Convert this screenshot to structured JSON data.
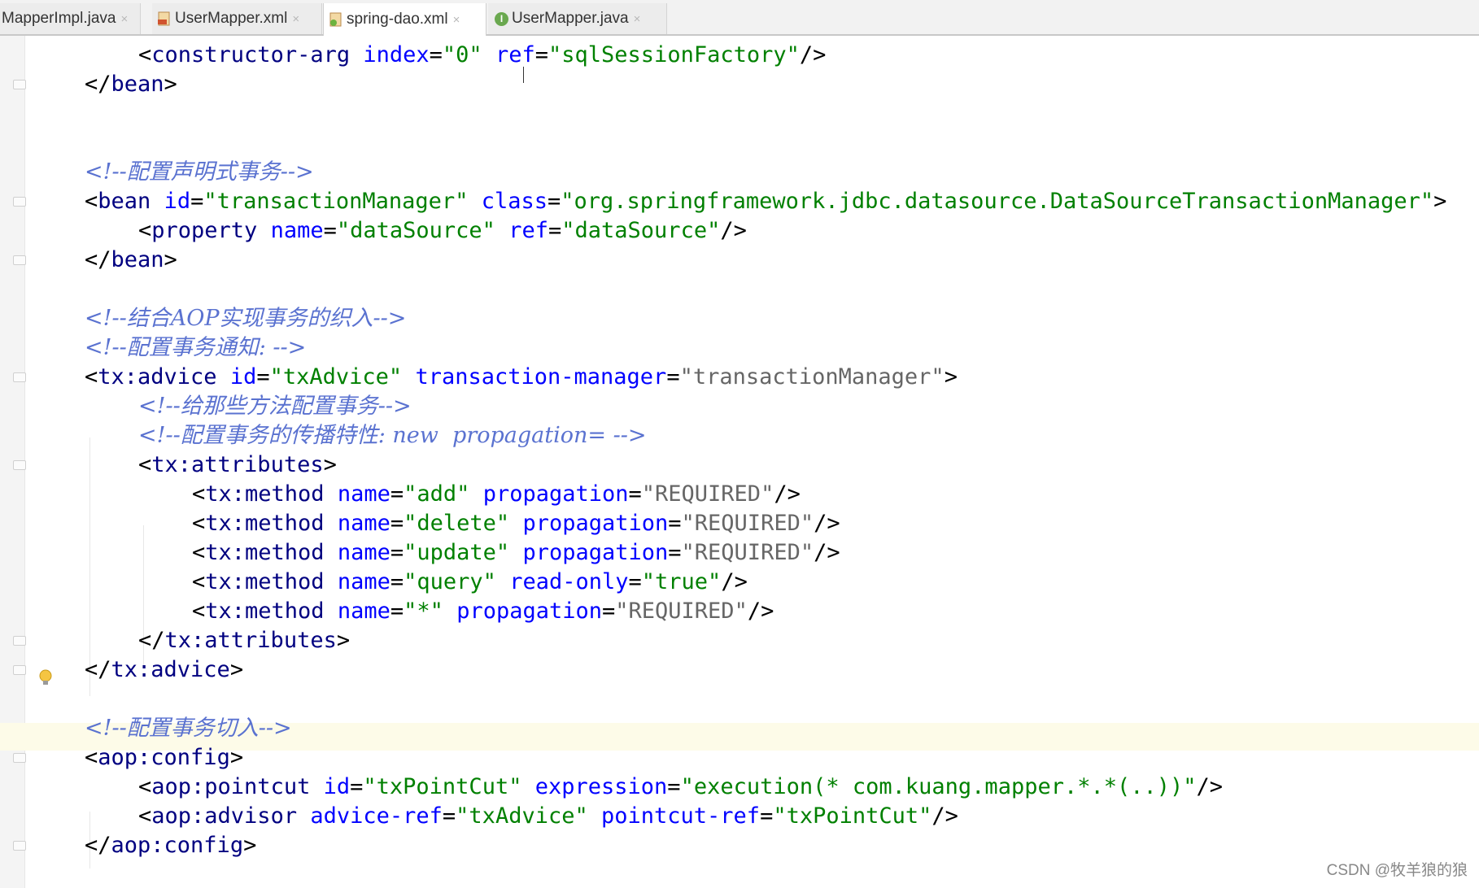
{
  "tabs": [
    {
      "label": "MapperImpl.java",
      "active": false
    },
    {
      "label": "UserMapper.xml",
      "active": false
    },
    {
      "label": "spring-dao.xml",
      "active": true
    },
    {
      "label": "UserMapper.java",
      "active": false
    }
  ],
  "tab_close_glyph": "×",
  "code_lines": [
    {
      "segments": [
        [
          "ang",
          "<"
        ],
        [
          "tag",
          "constructor-arg"
        ],
        [
          "ang",
          " "
        ],
        [
          "attr",
          "index"
        ],
        [
          "ang",
          "="
        ],
        [
          "val",
          "\"0\""
        ],
        [
          "ang",
          " "
        ],
        [
          "attr",
          "ref"
        ],
        [
          "ang",
          "="
        ],
        [
          "val",
          "\"sqlSessionFactory\""
        ],
        [
          "ang",
          "/>"
        ]
      ],
      "indent": 1
    },
    {
      "segments": [
        [
          "ang",
          "</"
        ],
        [
          "tag",
          "bean"
        ],
        [
          "ang",
          ">"
        ]
      ],
      "indent": 0
    },
    {
      "segments": [],
      "indent": 0
    },
    {
      "segments": [],
      "indent": 0
    },
    {
      "segments": [
        [
          "cmt",
          "<!--配置声明式事务-->"
        ]
      ],
      "indent": 0
    },
    {
      "segments": [
        [
          "ang",
          "<"
        ],
        [
          "tag",
          "bean"
        ],
        [
          "ang",
          " "
        ],
        [
          "attr",
          "id"
        ],
        [
          "ang",
          "="
        ],
        [
          "val",
          "\"transactionManager\""
        ],
        [
          "ang",
          " "
        ],
        [
          "attr",
          "class"
        ],
        [
          "ang",
          "="
        ],
        [
          "val",
          "\"org.springframework.jdbc.datasource.DataSourceTransactionManager\""
        ],
        [
          "ang",
          ">"
        ]
      ],
      "indent": 0
    },
    {
      "segments": [
        [
          "ang",
          "<"
        ],
        [
          "tag",
          "property"
        ],
        [
          "ang",
          " "
        ],
        [
          "attr",
          "name"
        ],
        [
          "ang",
          "="
        ],
        [
          "val",
          "\"dataSource\""
        ],
        [
          "ang",
          " "
        ],
        [
          "attr",
          "ref"
        ],
        [
          "ang",
          "="
        ],
        [
          "val",
          "\"dataSource\""
        ],
        [
          "ang",
          "/>"
        ]
      ],
      "indent": 1
    },
    {
      "segments": [
        [
          "ang",
          "</"
        ],
        [
          "tag",
          "bean"
        ],
        [
          "ang",
          ">"
        ]
      ],
      "indent": 0
    },
    {
      "segments": [],
      "indent": 0
    },
    {
      "segments": [
        [
          "cmt",
          "<!--结合AOP实现事务的织入-->"
        ]
      ],
      "indent": 0
    },
    {
      "segments": [
        [
          "cmt",
          "<!--配置事务通知: -->"
        ]
      ],
      "indent": 0
    },
    {
      "segments": [
        [
          "ang",
          "<"
        ],
        [
          "tag",
          "tx:advice"
        ],
        [
          "ang",
          " "
        ],
        [
          "attr",
          "id"
        ],
        [
          "ang",
          "="
        ],
        [
          "val",
          "\"txAdvice\""
        ],
        [
          "ang",
          " "
        ],
        [
          "attr",
          "transaction-manager"
        ],
        [
          "ang",
          "="
        ],
        [
          "gray",
          "\"transactionManager\""
        ],
        [
          "ang",
          ">"
        ]
      ],
      "indent": 0
    },
    {
      "segments": [
        [
          "cmt",
          "<!--给那些方法配置事务-->"
        ]
      ],
      "indent": 1
    },
    {
      "segments": [
        [
          "cmt",
          "<!--配置事务的传播特性: new  propagation= -->"
        ]
      ],
      "indent": 1
    },
    {
      "segments": [
        [
          "ang",
          "<"
        ],
        [
          "tag",
          "tx:attributes"
        ],
        [
          "ang",
          ">"
        ]
      ],
      "indent": 1
    },
    {
      "segments": [
        [
          "ang",
          "<"
        ],
        [
          "tag",
          "tx:method"
        ],
        [
          "ang",
          " "
        ],
        [
          "attr",
          "name"
        ],
        [
          "ang",
          "="
        ],
        [
          "val",
          "\"add\""
        ],
        [
          "ang",
          " "
        ],
        [
          "attr",
          "propagation"
        ],
        [
          "ang",
          "="
        ],
        [
          "gray",
          "\"REQUIRED\""
        ],
        [
          "ang",
          "/>"
        ]
      ],
      "indent": 2
    },
    {
      "segments": [
        [
          "ang",
          "<"
        ],
        [
          "tag",
          "tx:method"
        ],
        [
          "ang",
          " "
        ],
        [
          "attr",
          "name"
        ],
        [
          "ang",
          "="
        ],
        [
          "val",
          "\"delete\""
        ],
        [
          "ang",
          " "
        ],
        [
          "attr",
          "propagation"
        ],
        [
          "ang",
          "="
        ],
        [
          "gray",
          "\"REQUIRED\""
        ],
        [
          "ang",
          "/>"
        ]
      ],
      "indent": 2
    },
    {
      "segments": [
        [
          "ang",
          "<"
        ],
        [
          "tag",
          "tx:method"
        ],
        [
          "ang",
          " "
        ],
        [
          "attr",
          "name"
        ],
        [
          "ang",
          "="
        ],
        [
          "val",
          "\"update\""
        ],
        [
          "ang",
          " "
        ],
        [
          "attr",
          "propagation"
        ],
        [
          "ang",
          "="
        ],
        [
          "gray",
          "\"REQUIRED\""
        ],
        [
          "ang",
          "/>"
        ]
      ],
      "indent": 2
    },
    {
      "segments": [
        [
          "ang",
          "<"
        ],
        [
          "tag",
          "tx:method"
        ],
        [
          "ang",
          " "
        ],
        [
          "attr",
          "name"
        ],
        [
          "ang",
          "="
        ],
        [
          "val",
          "\"query\""
        ],
        [
          "ang",
          " "
        ],
        [
          "attr",
          "read-only"
        ],
        [
          "ang",
          "="
        ],
        [
          "val",
          "\"true\""
        ],
        [
          "ang",
          "/>"
        ]
      ],
      "indent": 2
    },
    {
      "segments": [
        [
          "ang",
          "<"
        ],
        [
          "tag",
          "tx:method"
        ],
        [
          "ang",
          " "
        ],
        [
          "attr",
          "name"
        ],
        [
          "ang",
          "="
        ],
        [
          "val",
          "\"*\""
        ],
        [
          "ang",
          " "
        ],
        [
          "attr",
          "propagation"
        ],
        [
          "ang",
          "="
        ],
        [
          "gray",
          "\"REQUIRED\""
        ],
        [
          "ang",
          "/>"
        ]
      ],
      "indent": 2
    },
    {
      "segments": [
        [
          "ang",
          "</"
        ],
        [
          "tag",
          "tx:attributes"
        ],
        [
          "ang",
          ">"
        ]
      ],
      "indent": 1
    },
    {
      "segments": [
        [
          "ang",
          "</"
        ],
        [
          "tag",
          "tx:advice"
        ],
        [
          "ang",
          ">"
        ]
      ],
      "indent": 0
    },
    {
      "segments": [],
      "indent": 0
    },
    {
      "segments": [
        [
          "cmt",
          "<!--配置事务切入-->"
        ]
      ],
      "indent": 0
    },
    {
      "segments": [
        [
          "ang",
          "<"
        ],
        [
          "tag",
          "aop:config"
        ],
        [
          "ang",
          ">"
        ]
      ],
      "indent": 0
    },
    {
      "segments": [
        [
          "ang",
          "<"
        ],
        [
          "tag",
          "aop:pointcut"
        ],
        [
          "ang",
          " "
        ],
        [
          "attr",
          "id"
        ],
        [
          "ang",
          "="
        ],
        [
          "val",
          "\"txPointCut\""
        ],
        [
          "ang",
          " "
        ],
        [
          "attr",
          "expression"
        ],
        [
          "ang",
          "="
        ],
        [
          "val",
          "\"execution(* com.kuang.mapper.*.*(..))\""
        ],
        [
          "ang",
          "/>"
        ]
      ],
      "indent": 1
    },
    {
      "segments": [
        [
          "ang",
          "<"
        ],
        [
          "tag",
          "aop:advisor"
        ],
        [
          "ang",
          " "
        ],
        [
          "attr",
          "advice-ref"
        ],
        [
          "ang",
          "="
        ],
        [
          "val",
          "\"txAdvice\""
        ],
        [
          "ang",
          " "
        ],
        [
          "attr",
          "pointcut-ref"
        ],
        [
          "ang",
          "="
        ],
        [
          "val",
          "\"txPointCut\""
        ],
        [
          "ang",
          "/>"
        ]
      ],
      "indent": 1
    },
    {
      "segments": [
        [
          "ang",
          "</"
        ],
        [
          "tag",
          "aop:config"
        ],
        [
          "ang",
          ">"
        ]
      ],
      "indent": 0
    }
  ],
  "watermark": "CSDN @牧羊狼的狼",
  "colors": {
    "tag": "#000080",
    "attribute": "#0000ff",
    "value": "#008000",
    "comment": "#5a72d0",
    "current_line": "#fdfbe8"
  }
}
